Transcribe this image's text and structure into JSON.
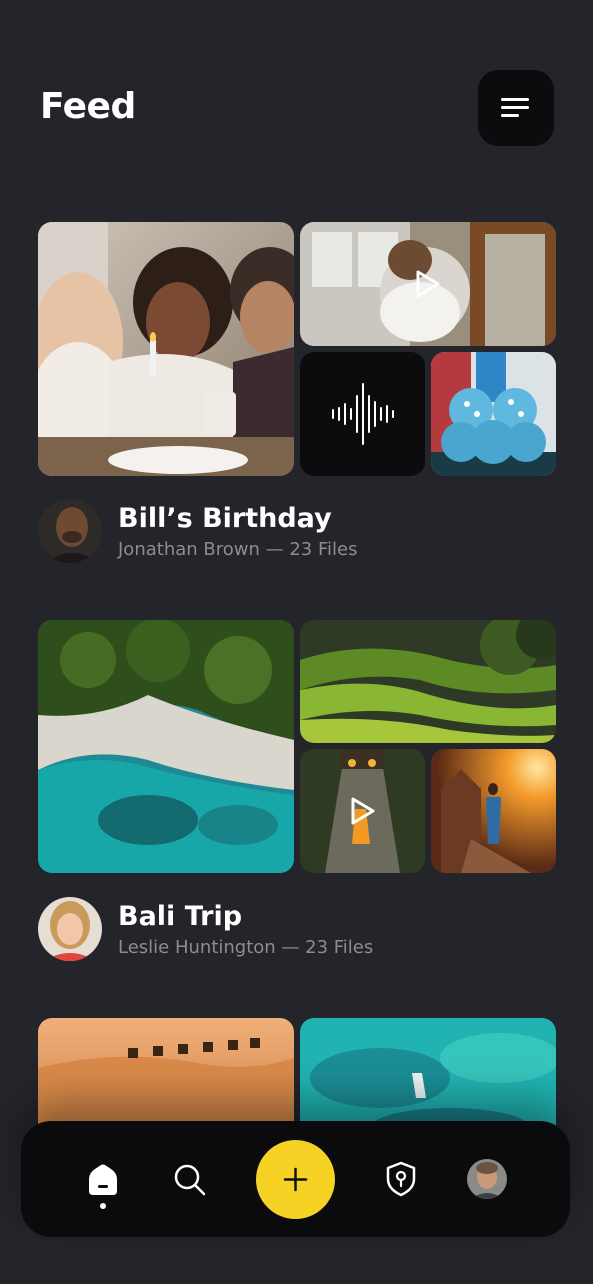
{
  "header": {
    "title": "Feed",
    "menu_icon": "menu-icon"
  },
  "feeds": [
    {
      "title": "Bill’s Birthday",
      "subtitle": "Jonathan Brown — 23 Files"
    },
    {
      "title": "Bali Trip",
      "subtitle": "Leslie Huntington — 23 Files"
    }
  ],
  "bottom_nav": {
    "items": [
      "home-icon",
      "search-icon",
      "add-icon",
      "location-shield-icon",
      "profile-avatar"
    ],
    "active": "home-icon"
  },
  "colors": {
    "background": "#23252b",
    "nav_background": "#0b0b0d",
    "accent": "#f5d224",
    "subtitle": "#8b8d92"
  }
}
